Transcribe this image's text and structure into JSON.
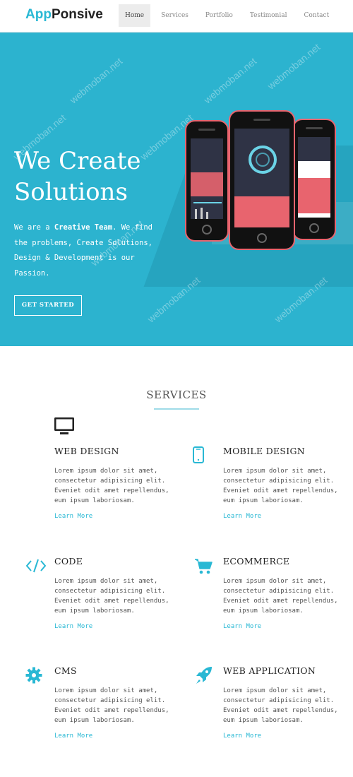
{
  "brand": {
    "part1": "App",
    "part2": "Ponsive"
  },
  "nav": [
    {
      "label": "Home",
      "active": true
    },
    {
      "label": "Services",
      "active": false
    },
    {
      "label": "Portfolio",
      "active": false
    },
    {
      "label": "Testimonial",
      "active": false
    },
    {
      "label": "Contact",
      "active": false
    }
  ],
  "hero": {
    "title": "We Create Solutions",
    "text_pre": "We are a ",
    "text_bold": "Creative Team",
    "text_post": ". We find the problems, Create Solutions, Design & Development is our Passion.",
    "cta_label": "GET STARTED",
    "watermark": "webmoban.net"
  },
  "services": {
    "title": "SERVICES",
    "items": [
      {
        "title": "WEB DESIGN",
        "icon": "monitor-icon",
        "text": "Lorem ipsum dolor sit amet, consectetur adipisicing elit. Eveniet odit amet repellendus, eum ipsum laboriosam.",
        "link": "Learn More"
      },
      {
        "title": "MOBILE DESIGN",
        "icon": "mobile-icon",
        "text": "Lorem ipsum dolor sit amet, consectetur adipisicing elit. Eveniet odit amet repellendus, eum ipsum laboriosam.",
        "link": "Learn More"
      },
      {
        "title": "CODE",
        "icon": "code-icon",
        "text": "Lorem ipsum dolor sit amet, consectetur adipisicing elit. Eveniet odit amet repellendus, eum ipsum laboriosam.",
        "link": "Learn More"
      },
      {
        "title": "ECOMMERCE",
        "icon": "cart-icon",
        "text": "Lorem ipsum dolor sit amet, consectetur adipisicing elit. Eveniet odit amet repellendus, eum ipsum laboriosam.",
        "link": "Learn More"
      },
      {
        "title": "CMS",
        "icon": "gear-icon",
        "text": "Lorem ipsum dolor sit amet, consectetur adipisicing elit. Eveniet odit amet repellendus, eum ipsum laboriosam.",
        "link": "Learn More"
      },
      {
        "title": "WEB APPLICATION",
        "icon": "rocket-icon",
        "text": "Lorem ipsum dolor sit amet, consectetur adipisicing elit. Eveniet odit amet repellendus, eum ipsum laboriosam.",
        "link": "Learn More"
      }
    ]
  },
  "colors": {
    "accent": "#29b8d4",
    "hero_bg": "#2cb3cf",
    "phone_pink": "#e8646e"
  }
}
